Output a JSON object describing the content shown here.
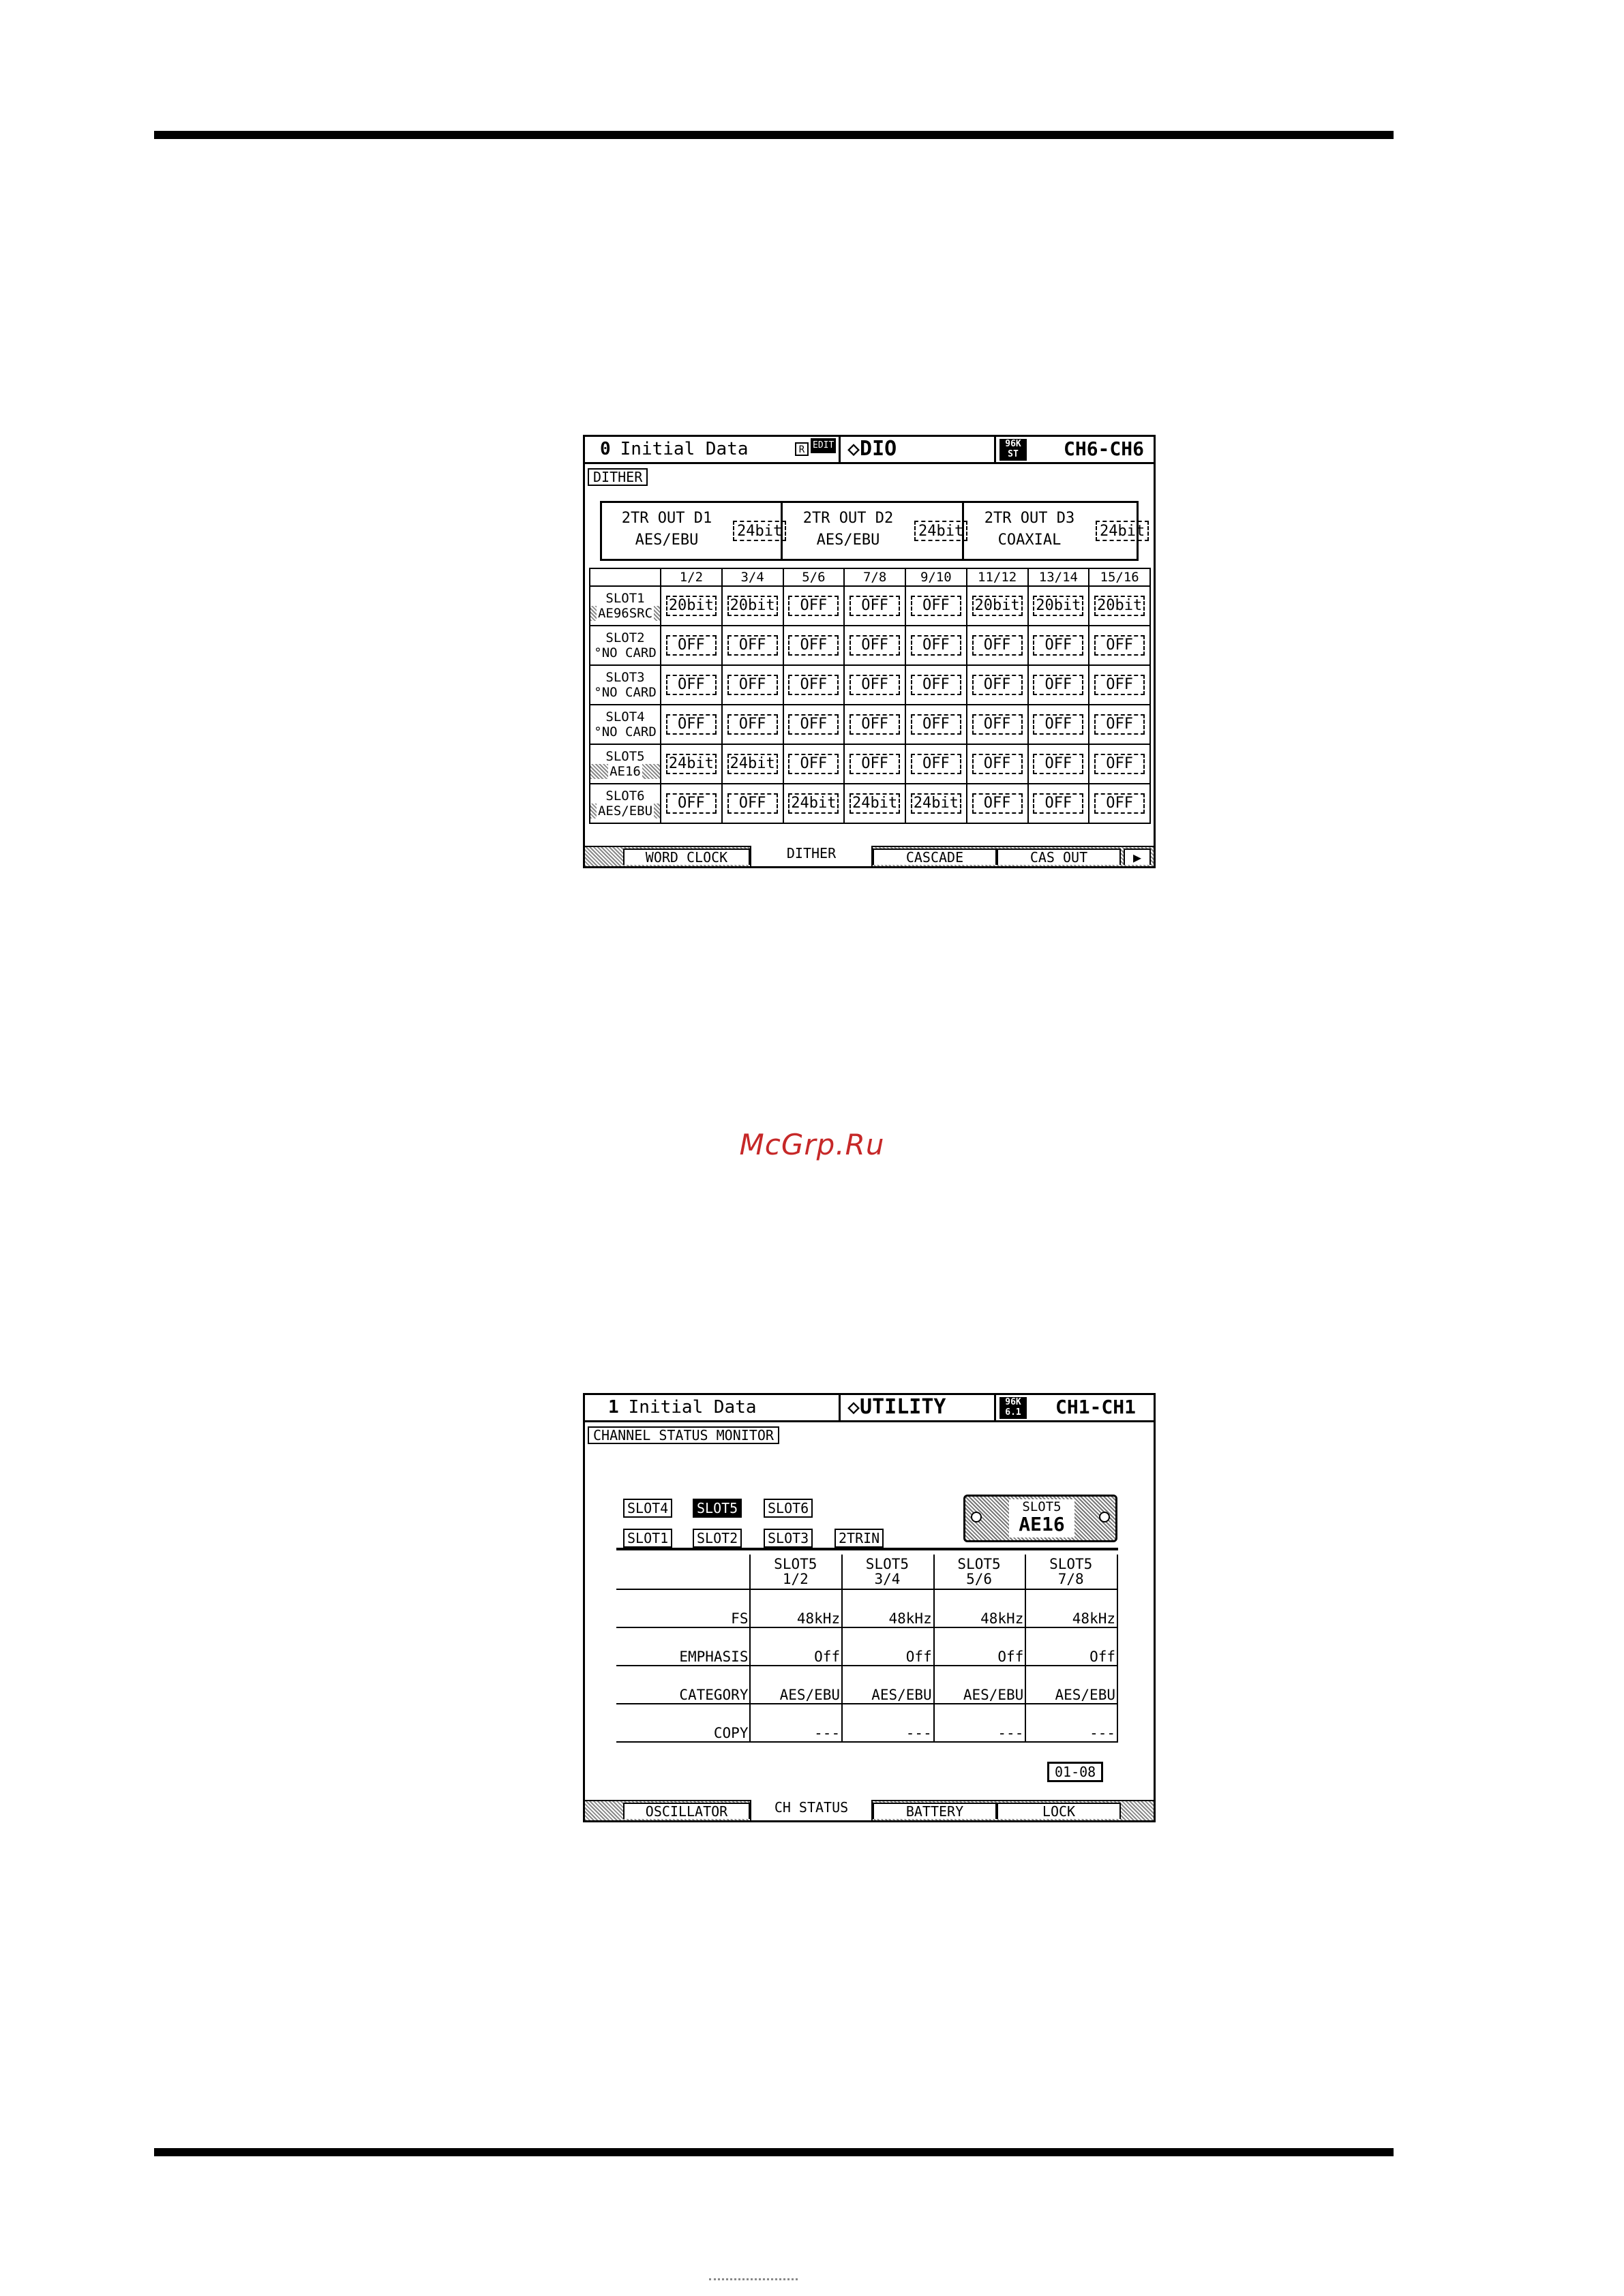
{
  "watermark": "McGrp.Ru",
  "dio": {
    "scene_number": "0",
    "scene_name": "Initial Data",
    "r_badge": "R",
    "edit_badge": "EDIT",
    "function": "◇DIO",
    "rate_top": "96K",
    "rate_bottom": "ST",
    "channel": "CH6-CH6",
    "section": "DITHER",
    "outputs": [
      {
        "name": "2TR OUT D1",
        "format": "AES/EBU",
        "bit": "24bit"
      },
      {
        "name": "2TR OUT D2",
        "format": "AES/EBU",
        "bit": "24bit"
      },
      {
        "name": "2TR OUT D3",
        "format": "COAXIAL",
        "bit": "24bit"
      }
    ],
    "columns": [
      "1/2",
      "3/4",
      "5/6",
      "7/8",
      "9/10",
      "11/12",
      "13/14",
      "15/16"
    ],
    "slots": [
      {
        "name": "SLOT1",
        "card": "AE96SRC",
        "values": [
          "20bit",
          "20bit",
          "OFF",
          "OFF",
          "OFF",
          "20bit",
          "20bit",
          "20bit"
        ]
      },
      {
        "name": "SLOT2",
        "card": "NO CARD",
        "values": [
          "OFF",
          "OFF",
          "OFF",
          "OFF",
          "OFF",
          "OFF",
          "OFF",
          "OFF"
        ]
      },
      {
        "name": "SLOT3",
        "card": "NO CARD",
        "values": [
          "OFF",
          "OFF",
          "OFF",
          "OFF",
          "OFF",
          "OFF",
          "OFF",
          "OFF"
        ]
      },
      {
        "name": "SLOT4",
        "card": "NO CARD",
        "values": [
          "OFF",
          "OFF",
          "OFF",
          "OFF",
          "OFF",
          "OFF",
          "OFF",
          "OFF"
        ]
      },
      {
        "name": "SLOT5",
        "card": "AE16",
        "values": [
          "24bit",
          "24bit",
          "OFF",
          "OFF",
          "OFF",
          "OFF",
          "OFF",
          "OFF"
        ]
      },
      {
        "name": "SLOT6",
        "card": "AES/EBU",
        "values": [
          "OFF",
          "OFF",
          "24bit",
          "24bit",
          "24bit",
          "OFF",
          "OFF",
          "OFF"
        ]
      }
    ],
    "tabs": [
      "WORD CLOCK",
      "DITHER",
      "CASCADE",
      "CAS OUT",
      "▶"
    ],
    "active_tab": "DITHER"
  },
  "utility": {
    "scene_number": "1",
    "scene_name": "Initial Data",
    "function": "◇UTILITY",
    "rate_top": "96K",
    "rate_bottom": "6.1",
    "channel": "CH1-CH1",
    "section": "CHANNEL STATUS MONITOR",
    "slot_buttons_row1": [
      "SLOT4",
      "SLOT5",
      "SLOT6"
    ],
    "slot_buttons_row2": [
      "SLOT1",
      "SLOT2",
      "SLOT3",
      "2TRIN"
    ],
    "selected_slot": "SLOT5",
    "card_slot": "SLOT5",
    "card_name": "AE16",
    "columns": [
      {
        "slot": "SLOT5",
        "pair": "1/2"
      },
      {
        "slot": "SLOT5",
        "pair": "3/4"
      },
      {
        "slot": "SLOT5",
        "pair": "5/6"
      },
      {
        "slot": "SLOT5",
        "pair": "7/8"
      }
    ],
    "rows": [
      {
        "label": "FS",
        "values": [
          "48kHz",
          "48kHz",
          "48kHz",
          "48kHz"
        ]
      },
      {
        "label": "EMPHASIS",
        "values": [
          "Off",
          "Off",
          "Off",
          "Off"
        ]
      },
      {
        "label": "CATEGORY",
        "values": [
          "AES/EBU",
          "AES/EBU",
          "AES/EBU",
          "AES/EBU"
        ]
      },
      {
        "label": "COPY",
        "values": [
          "---",
          "---",
          "---",
          "---"
        ]
      }
    ],
    "pager": "01-08",
    "tabs": [
      "OSCILLATOR",
      "CH STATUS",
      "BATTERY",
      "LOCK"
    ],
    "active_tab": "CH STATUS"
  }
}
